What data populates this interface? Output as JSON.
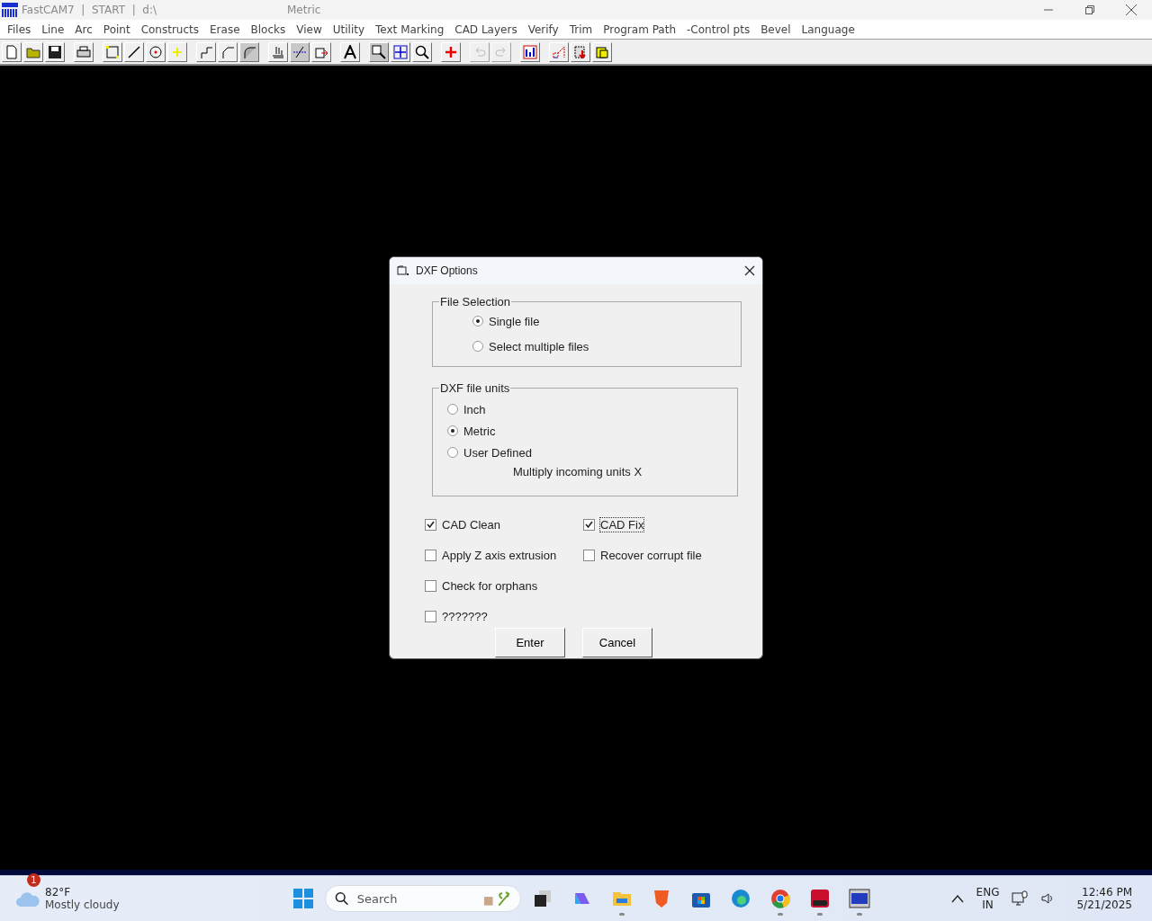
{
  "window": {
    "title": "FastCAM7  |  START  |  d:\\",
    "subtitle": "Metric"
  },
  "menu": [
    "Files",
    "Line",
    "Arc",
    "Point",
    "Constructs",
    "Erase",
    "Blocks",
    "View",
    "Utility",
    "Text Marking",
    "CAD Layers",
    "Verify",
    "Trim",
    "Program Path",
    "-Control pts",
    "Bevel",
    "Language"
  ],
  "toolbar": [
    [
      {
        "kind": "new",
        "disabled": false
      },
      {
        "kind": "open",
        "disabled": false
      },
      {
        "kind": "save",
        "disabled": false
      }
    ],
    [
      {
        "kind": "print",
        "disabled": false
      }
    ],
    [
      {
        "kind": "rect",
        "disabled": false
      },
      {
        "kind": "line",
        "disabled": false
      },
      {
        "kind": "circle",
        "disabled": false
      },
      {
        "kind": "point",
        "disabled": false
      }
    ],
    [
      {
        "kind": "step",
        "disabled": false
      },
      {
        "kind": "chamfer",
        "disabled": false
      },
      {
        "kind": "fillet",
        "disabled": false
      }
    ],
    [
      {
        "kind": "hand",
        "disabled": false
      },
      {
        "kind": "cut",
        "disabled": false
      },
      {
        "kind": "export",
        "disabled": false
      }
    ],
    [
      {
        "kind": "text",
        "disabled": false
      }
    ],
    [
      {
        "kind": "zoom",
        "disabled": false
      },
      {
        "kind": "fit",
        "disabled": false
      },
      {
        "kind": "zoomprev",
        "disabled": false
      }
    ],
    [
      {
        "kind": "cross",
        "disabled": false
      }
    ],
    [
      {
        "kind": "undo",
        "disabled": true
      },
      {
        "kind": "redo",
        "disabled": true
      }
    ],
    [
      {
        "kind": "chart",
        "disabled": false
      }
    ],
    [
      {
        "kind": "path",
        "disabled": false
      },
      {
        "kind": "download",
        "disabled": false
      },
      {
        "kind": "folder",
        "disabled": false
      }
    ]
  ],
  "dialog": {
    "title": "DXF Options",
    "file_selection": {
      "label": "File Selection",
      "options": [
        {
          "label": "Single file",
          "selected": true
        },
        {
          "label": "Select multiple files",
          "selected": false
        }
      ]
    },
    "units": {
      "label": "DXF file units",
      "options": [
        {
          "label": "Inch",
          "selected": false
        },
        {
          "label": "Metric",
          "selected": true
        },
        {
          "label": "User Defined",
          "selected": false
        }
      ],
      "multiply_label": "Multiply incoming units X"
    },
    "checkbox_rows": [
      [
        {
          "label": "CAD Clean",
          "checked": true,
          "focused": false
        },
        {
          "label": "CAD Fix",
          "checked": true,
          "focused": true
        }
      ],
      [
        {
          "label": "Apply Z axis extrusion",
          "checked": false,
          "focused": false
        },
        {
          "label": "Recover corrupt file",
          "checked": false,
          "focused": false
        }
      ],
      [
        {
          "label": "Check for orphans",
          "checked": false,
          "focused": false
        }
      ],
      [
        {
          "label": "???????",
          "checked": false,
          "focused": false
        }
      ]
    ],
    "buttons": [
      "Enter",
      "Cancel"
    ]
  },
  "taskbar": {
    "weather": {
      "badge": "1",
      "temperature": "82°F",
      "condition": "Mostly cloudy"
    },
    "search": {
      "placeholder": "Search"
    },
    "apps": [
      {
        "kind": "start",
        "running": false
      },
      {
        "kind": "taskview",
        "running": false
      },
      {
        "kind": "copilot",
        "running": false
      },
      {
        "kind": "explorer",
        "running": true
      },
      {
        "kind": "brave",
        "running": false
      },
      {
        "kind": "store",
        "running": false
      },
      {
        "kind": "edge",
        "running": false
      },
      {
        "kind": "chrome",
        "running": true
      },
      {
        "kind": "solidworks",
        "running": true
      },
      {
        "kind": "fastcam",
        "running": true
      }
    ],
    "language": [
      "ENG",
      "IN"
    ],
    "time": "12:46 PM",
    "date": "5/21/2025"
  }
}
